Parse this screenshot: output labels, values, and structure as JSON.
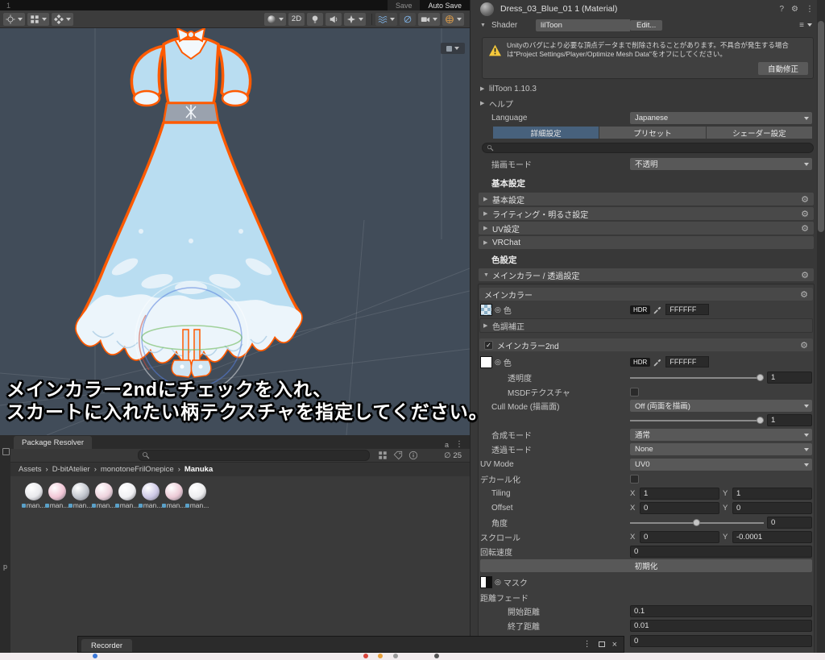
{
  "colors": {
    "accent_tab": "#47617c",
    "selection_outline": "#ff5a00",
    "warning": "#f5c93c",
    "scene_bg": "#414c59"
  },
  "icons": {
    "gear": "⚙",
    "fold_open": "▼",
    "fold_closed": "▶",
    "kebab": "⋮",
    "help": "?",
    "presets": "⚙",
    "check": "✓",
    "picker": "◎",
    "crumb_sep": "›",
    "close": "×",
    "menu": "≡",
    "hidden": "∅"
  },
  "scene": {
    "window_index": "1",
    "save": "Save",
    "autosave": "Auto Save",
    "view2d": "2D",
    "overlay": {
      "line1": "メインカラー2ndにチェックを入れ、",
      "line2": "スカートに入れたい柄テクスチャを指定してください。"
    }
  },
  "project": {
    "tab": "Package Resolver",
    "hidden_count": "25",
    "side_tab": "p",
    "breadcrumb": [
      "Assets",
      "D-bitAtelier",
      "monotoneFrilOnepice",
      "Manuka"
    ],
    "items": [
      {
        "label": "man...",
        "color": "#e9e9ec"
      },
      {
        "label": "man...",
        "color": "#f2c6d6"
      },
      {
        "label": "man...",
        "color": "#c2c6ce"
      },
      {
        "label": "man...",
        "color": "#eed3dd"
      },
      {
        "label": "man...",
        "color": "#f0f0f3"
      },
      {
        "label": "man...",
        "color": "#cdc8e6"
      },
      {
        "label": "man...",
        "color": "#eccad6"
      },
      {
        "label": "man...",
        "color": "#ededef"
      }
    ]
  },
  "recorder": {
    "tab": "Recorder"
  },
  "inspector": {
    "title": "Dress_03_Blue_01 1 (Material)",
    "shader_label": "Shader",
    "shader_value": "lilToon",
    "edit_button": "Edit...",
    "warning_text": "Unityのバグにより必要な頂点データまで削除されることがあります。不具合が発生する場合は\"Project Settings/Player/Optimize Mesh Data\"をオフにしてください。",
    "warning_button": "自動修正",
    "version_foldout": "lilToon 1.10.3",
    "help_foldout": "ヘルプ",
    "language_label": "Language",
    "language_value": "Japanese",
    "tabs": [
      "詳細設定",
      "プリセット",
      "シェーダー設定"
    ],
    "render_mode_label": "描画モード",
    "render_mode_value": "不透明",
    "section_base": "基本設定",
    "base_rows": [
      "基本設定",
      "ライティング・明るさ設定",
      "UV設定",
      "VRChat"
    ],
    "section_color": "色設定",
    "main_group_label": "メインカラー / 透過設定",
    "main_header": "メインカラー",
    "color_label": "色",
    "hdr": "HDR",
    "hex": "FFFFFF",
    "tone_foldout": "色調補正",
    "main2nd_header": "メインカラー2nd",
    "axis_x": "X",
    "axis_y": "Y",
    "alpha_label": "透明度",
    "alpha_value": "1",
    "msdf_label": "MSDFテクスチャ",
    "cull_label": "Cull Mode (描画面)",
    "cull_value": "Off (両面を描画)",
    "blend_value": "1",
    "blendmode_label": "合成モード",
    "blendmode_value": "通常",
    "alphamode_label": "透過モード",
    "alphamode_value": "None",
    "uvmode_label": "UV Mode",
    "uvmode_value": "UV0",
    "decal_label": "デカール化",
    "tiling_label": "Tiling",
    "tiling_x": "1",
    "tiling_y": "1",
    "offset_label": "Offset",
    "offset_x": "0",
    "offset_y": "0",
    "angle_label": "角度",
    "angle_value": "0",
    "scroll_label": "スクロール",
    "scroll_x": "0",
    "scroll_y": "-0.0001",
    "rotation_label": "回転速度",
    "rotation_value": "0",
    "reset_button": "初期化",
    "mask_label": "マスク",
    "fade_label": "距離フェード",
    "fade_start_label": "開始距離",
    "fade_start": "0.1",
    "fade_end_label": "終了距離",
    "fade_end": "0.01",
    "fade_extra": "0"
  }
}
